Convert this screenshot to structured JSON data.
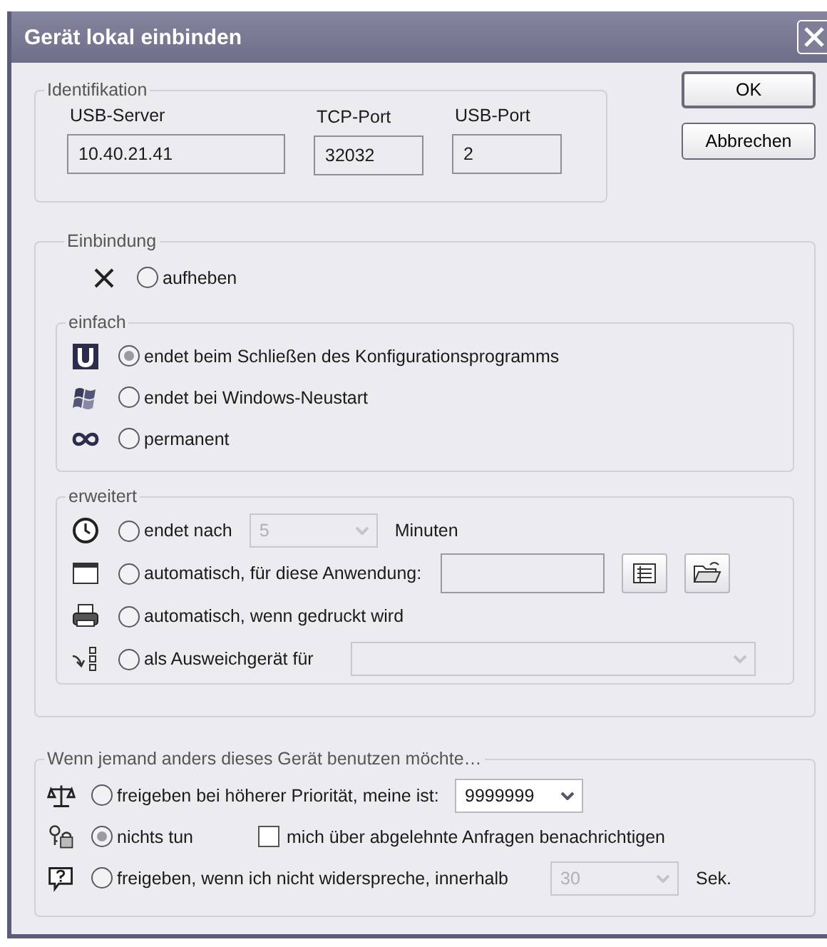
{
  "window": {
    "title": "Gerät lokal einbinden"
  },
  "identification": {
    "legend": "Identifikation",
    "fields": [
      {
        "label": "USB-Server",
        "value": "10.40.21.41"
      },
      {
        "label": "TCP-Port",
        "value": "32032"
      },
      {
        "label": "USB-Port",
        "value": "2"
      }
    ]
  },
  "buttons": [
    "OK",
    "Abbrechen"
  ],
  "binding": {
    "legend": "Einbindung",
    "remove": {
      "label": "aufheben",
      "selected": false
    },
    "simple": {
      "legend": "einfach",
      "options": [
        {
          "label": "endet beim Schließen des Konfigurationsprogramms",
          "selected": true
        },
        {
          "label": "endet bei Windows-Neustart",
          "selected": false
        },
        {
          "label": "permanent",
          "selected": false
        }
      ]
    },
    "extended": {
      "legend": "erweitert",
      "options": [
        {
          "kind": "duration",
          "label": "endet nach",
          "selected": false,
          "dropdown": {
            "value": "5",
            "disabled": true
          },
          "unit": "Minuten"
        },
        {
          "kind": "application",
          "label": "automatisch, für diese Anwendung:",
          "selected": false
        },
        {
          "kind": "plain",
          "label": "automatisch, wenn gedruckt wird",
          "selected": false
        },
        {
          "kind": "fallback",
          "label": "als Ausweichgerät für",
          "selected": false,
          "dropdown": {
            "disabled": true
          }
        }
      ]
    }
  },
  "conflict": {
    "legend": "Wenn jemand anders dieses Gerät benutzen möchte…",
    "options": [
      {
        "kind": "priority",
        "label": "freigeben bei höherer Priorität, meine ist:",
        "selected": false,
        "dropdown": {
          "value": "9999999",
          "disabled": false
        }
      },
      {
        "kind": "checkbox",
        "label": "nichts tun",
        "selected": true,
        "checkbox": {
          "label": "mich über abgelehnte Anfragen benachrichtigen",
          "checked": false
        }
      },
      {
        "kind": "timeout",
        "label": "freigeben, wenn ich nicht widerspreche, innerhalb",
        "selected": false,
        "dropdown": {
          "value": "30",
          "disabled": true
        },
        "unit": "Sek."
      }
    ]
  }
}
